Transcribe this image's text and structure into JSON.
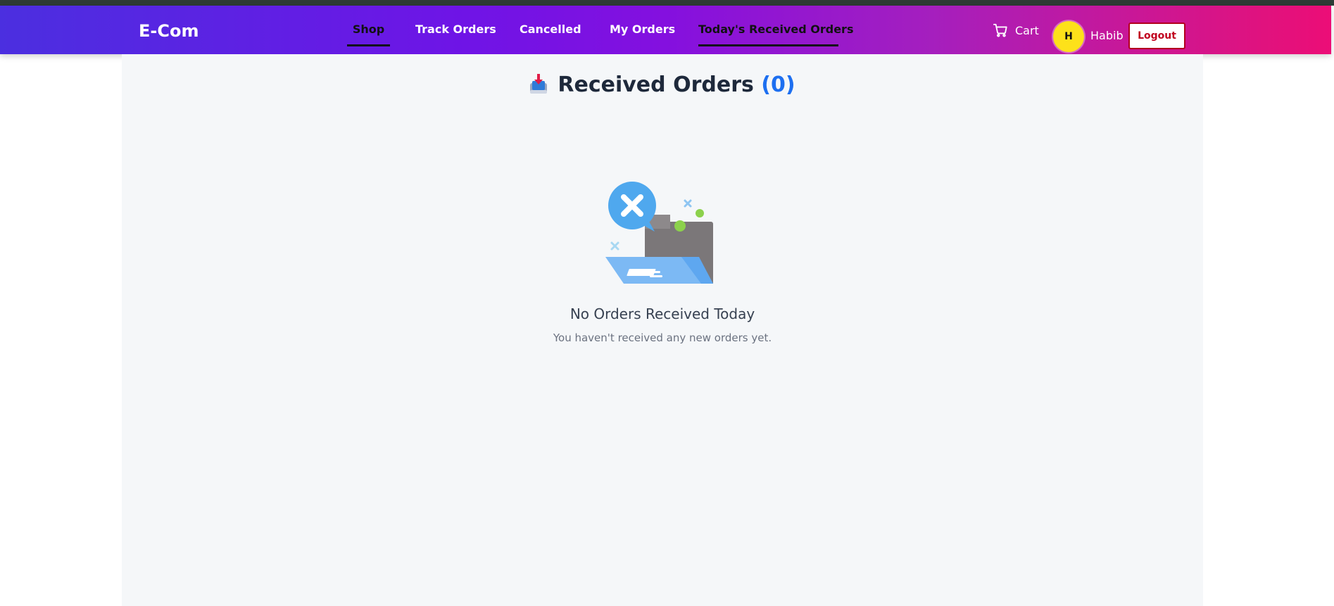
{
  "app": {
    "brand": "E-Com"
  },
  "nav": {
    "items": [
      {
        "label": "Shop",
        "active": true
      },
      {
        "label": "Track Orders",
        "active": false
      },
      {
        "label": "Cancelled",
        "active": false
      },
      {
        "label": "My Orders",
        "active": false
      },
      {
        "label": "Today's Received Orders",
        "active": true
      }
    ],
    "cart_label": "Cart",
    "user_initial": "H",
    "user_name": "Habib",
    "logout_label": "Logout"
  },
  "page": {
    "title": "Received Orders",
    "count": "(0)",
    "icon": "inbox-tray-icon"
  },
  "empty_state": {
    "title": "No Orders Received Today",
    "subtitle": "You haven't received any new orders yet.",
    "icon": "empty-folder-illustration"
  },
  "colors": {
    "nav_gradient_start": "#4b2fe0",
    "nav_gradient_end": "#ec0d77",
    "count_accent": "#1d6ff0",
    "avatar_bg": "#fde11a",
    "logout_border": "#b3001e"
  }
}
